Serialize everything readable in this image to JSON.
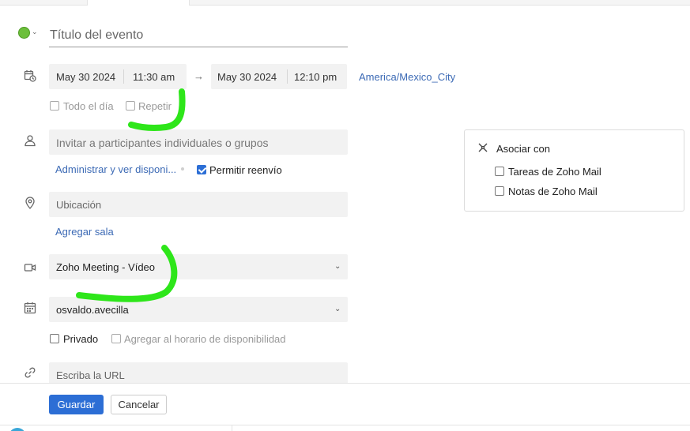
{
  "event": {
    "title_placeholder": "Título del evento",
    "color": "#6cbf3b"
  },
  "datetime": {
    "start_date": "May 30 2024",
    "start_time": "11:30 am",
    "end_date": "May 30 2024",
    "end_time": "12:10 pm",
    "timezone": "America/Mexico_City",
    "all_day_label": "Todo el día",
    "all_day_checked": false,
    "repeat_label": "Repetir",
    "repeat_checked": false
  },
  "participants": {
    "placeholder": "Invitar a participantes individuales o grupos",
    "manage_link": "Administrar y ver disponi...",
    "allow_forward_label": "Permitir reenvío",
    "allow_forward_checked": true
  },
  "location": {
    "placeholder": "Ubicación",
    "add_room_link": "Agregar sala"
  },
  "meeting": {
    "selected": "Zoho Meeting - Vídeo"
  },
  "calendar": {
    "selected": "osvaldo.avecilla",
    "private_label": "Privado",
    "private_checked": false,
    "availability_label": "Agregar al horario de disponibilidad",
    "availability_checked": false
  },
  "url": {
    "placeholder": "Escriba la URL"
  },
  "associate": {
    "title": "Asociar con",
    "options": [
      {
        "label": "Tareas de Zoho Mail",
        "checked": false
      },
      {
        "label": "Notas de Zoho Mail",
        "checked": false
      }
    ]
  },
  "footer": {
    "save_label": "Guardar",
    "cancel_label": "Cancelar"
  },
  "colors": {
    "accent": "#2c6ed5",
    "link": "#3c6ab5",
    "annotation": "#2ee61a"
  }
}
